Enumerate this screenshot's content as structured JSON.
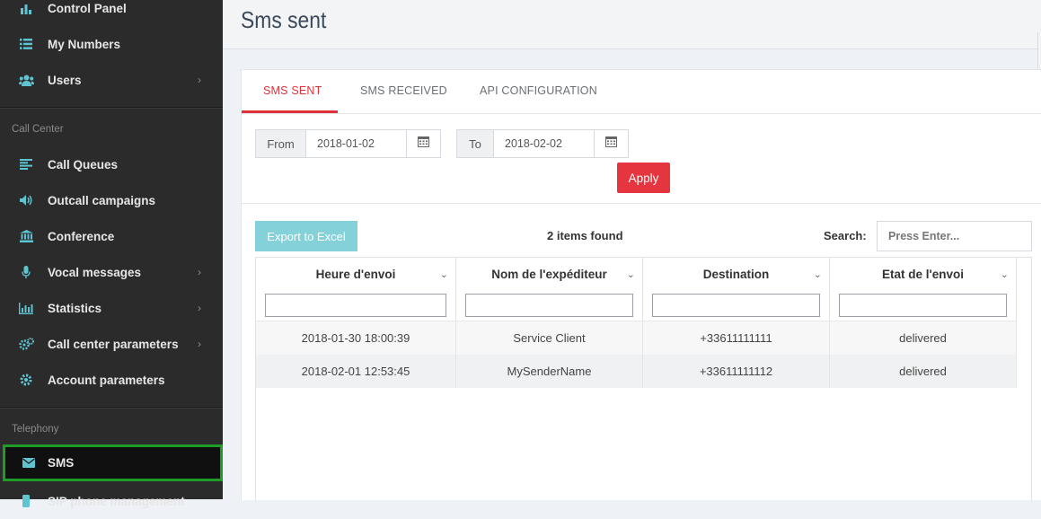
{
  "sidebar": {
    "items_top": [
      {
        "label": "Control Panel",
        "icon": "bar-chart-icon"
      },
      {
        "label": "My Numbers",
        "icon": "list-icon"
      },
      {
        "label": "Users",
        "icon": "users-icon",
        "chevron": "›"
      }
    ],
    "section_call_center": "Call Center",
    "items_cc": [
      {
        "label": "Call Queues",
        "icon": "align-left-icon"
      },
      {
        "label": "Outcall campaigns",
        "icon": "volume-icon"
      },
      {
        "label": "Conference",
        "icon": "institution-icon"
      },
      {
        "label": "Vocal messages",
        "icon": "microphone-icon",
        "chevron": "›"
      },
      {
        "label": "Statistics",
        "icon": "line-chart-icon",
        "chevron": "›"
      },
      {
        "label": "Call center parameters",
        "icon": "cogs-icon",
        "chevron": "›"
      },
      {
        "label": "Account parameters",
        "icon": "cog-icon"
      }
    ],
    "section_telephony": "Telephony",
    "items_tel": [
      {
        "label": "SMS",
        "icon": "envelope-icon"
      },
      {
        "label": "SIP phone management",
        "icon": "phone-icon"
      }
    ]
  },
  "header": {
    "title": "Sms sent"
  },
  "tabs": [
    {
      "label": "SMS SENT",
      "active": true
    },
    {
      "label": "SMS RECEIVED",
      "active": false
    },
    {
      "label": "API CONFIGURATION",
      "active": false
    }
  ],
  "filters": {
    "from_label": "From",
    "from_value": "2018-01-02",
    "to_label": "To",
    "to_value": "2018-02-02",
    "apply_label": "Apply"
  },
  "toolbar": {
    "export_label": "Export to Excel",
    "items_found": "2 items found",
    "search_label": "Search:",
    "search_placeholder": "Press Enter..."
  },
  "table": {
    "columns": [
      "Heure d'envoi",
      "Nom de l'expéditeur",
      "Destination",
      "Etat de l'envoi"
    ],
    "rows": [
      [
        "2018-01-30 18:00:39",
        "Service Client",
        "+33611111111",
        "delivered"
      ],
      [
        "2018-02-01 12:53:45",
        "MySenderName",
        "+33611111112",
        "delivered"
      ]
    ]
  },
  "colors": {
    "accent": "#e0313a",
    "sidebar_bg": "#2b2b2b",
    "icon": "#5ec4d1",
    "active_border": "#1e9c27",
    "excel_btn": "#84d1da"
  }
}
